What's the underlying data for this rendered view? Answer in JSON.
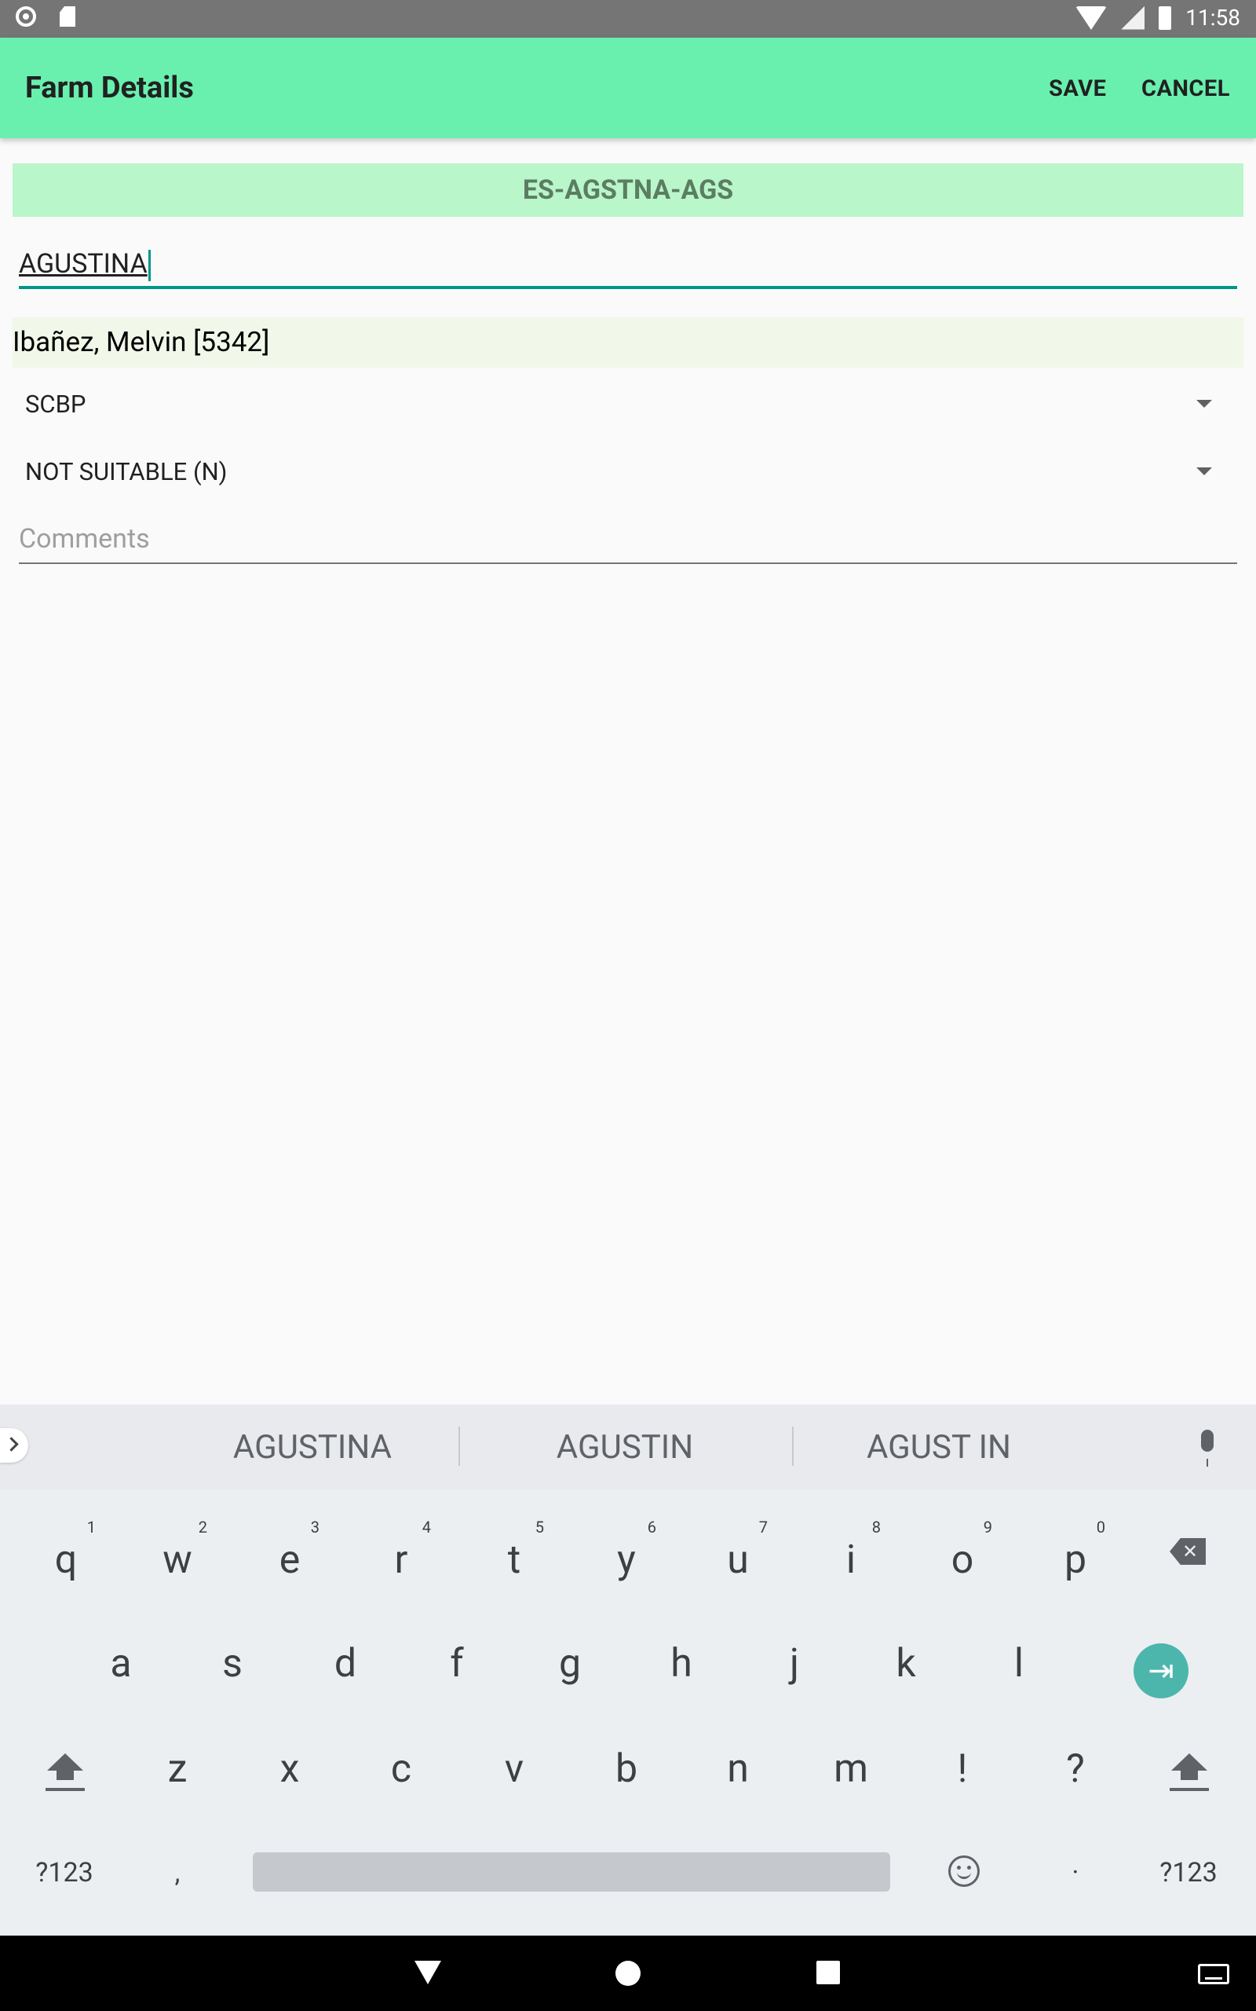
{
  "status_bar": {
    "time": "11:58"
  },
  "app_bar": {
    "title": "Farm Details",
    "save_label": "SAVE",
    "cancel_label": "CANCEL"
  },
  "form": {
    "farm_code": "ES-AGSTNA-AGS",
    "farm_name": "AGUSTINA",
    "owner": "Ibañez, Melvin [5342]",
    "program_select": "SCBP",
    "suitability_select": "NOT SUITABLE (N)",
    "comments_placeholder": "Comments"
  },
  "keyboard": {
    "suggestions": [
      "AGUSTINA",
      "AGUSTIN",
      "AGUST IN"
    ],
    "row1": [
      "q",
      "w",
      "e",
      "r",
      "t",
      "y",
      "u",
      "i",
      "o",
      "p"
    ],
    "row1_hints": [
      "1",
      "2",
      "3",
      "4",
      "5",
      "6",
      "7",
      "8",
      "9",
      "0"
    ],
    "row2": [
      "a",
      "s",
      "d",
      "f",
      "g",
      "h",
      "j",
      "k",
      "l"
    ],
    "row3": [
      "z",
      "x",
      "c",
      "v",
      "b",
      "n",
      "m",
      "!",
      "?"
    ],
    "symbols_label": "?123",
    "comma": ",",
    "period": "·",
    "enter_glyph": "⇥"
  }
}
